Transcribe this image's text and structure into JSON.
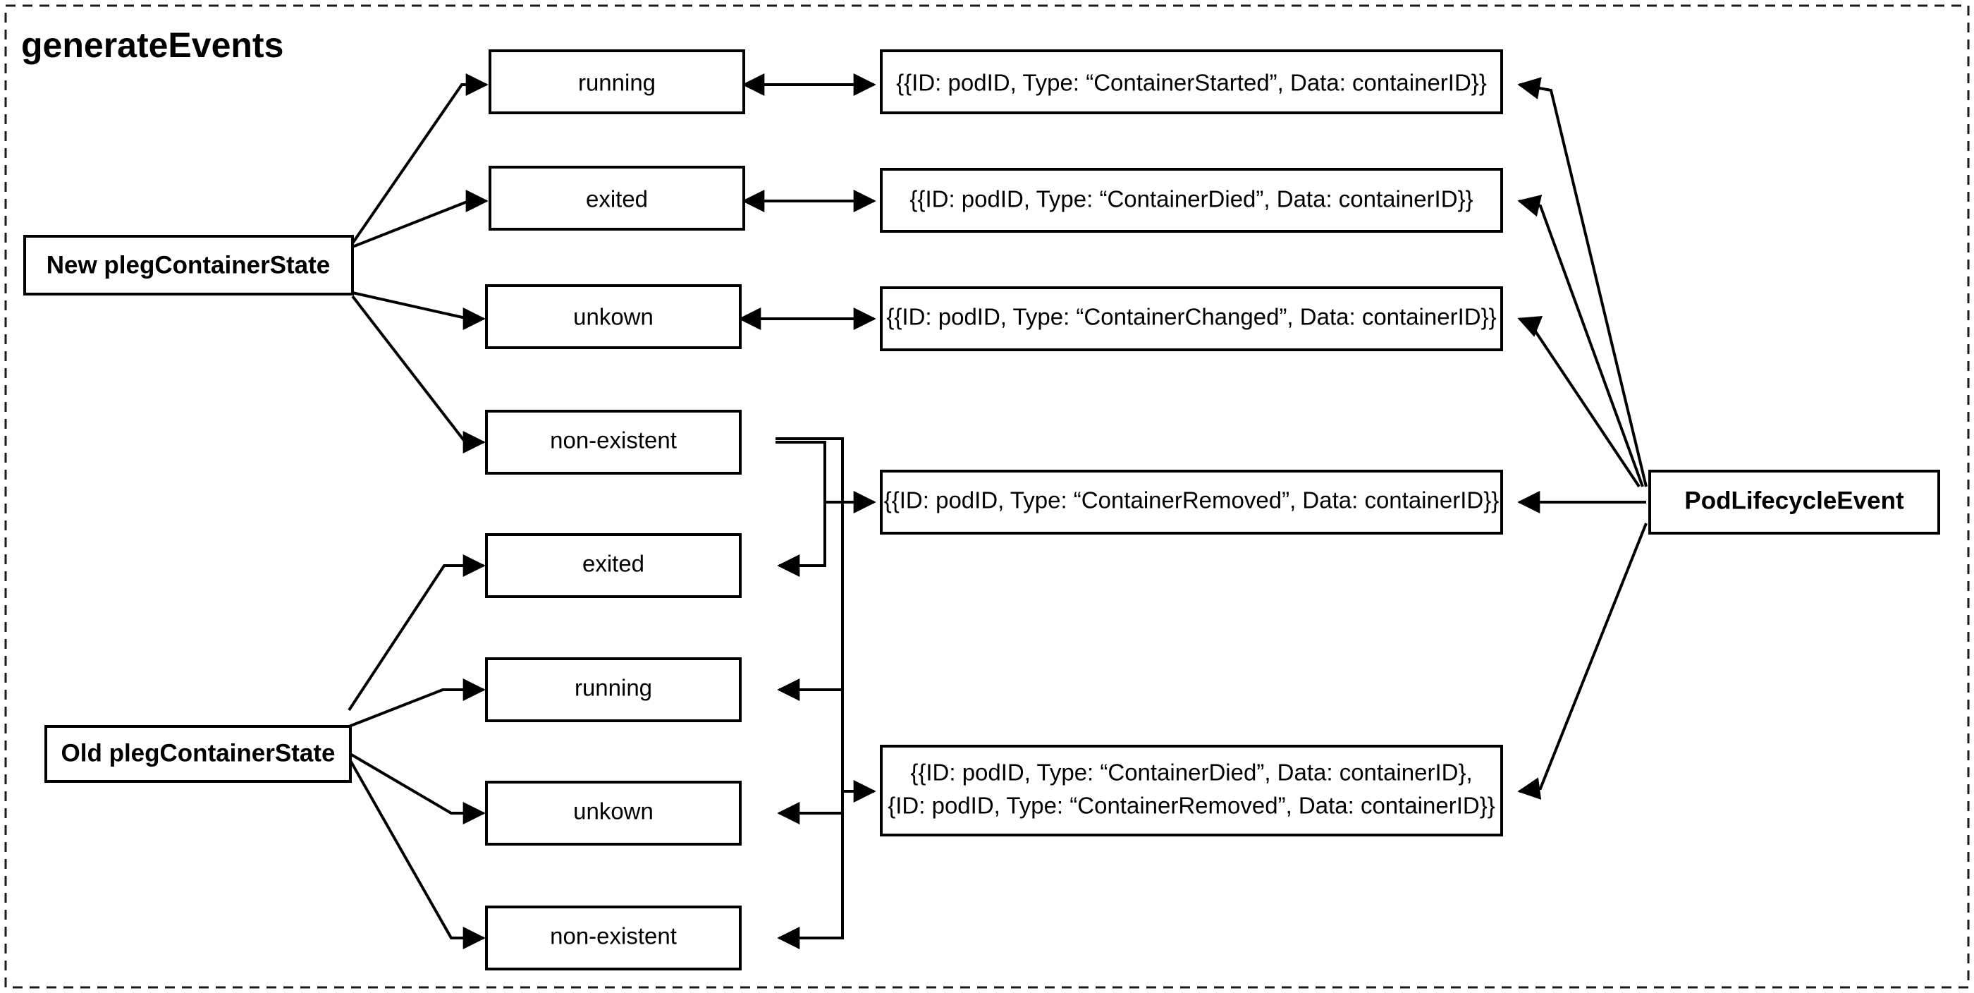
{
  "diagram": {
    "title": "generateEvents",
    "sources": [
      {
        "id": "new-state",
        "label": "New plegContainerState"
      },
      {
        "id": "old-state",
        "label": "Old plegContainerState"
      }
    ],
    "sink": {
      "id": "pod-lifecycle-event",
      "label": "PodLifecycleEvent"
    },
    "new_states": [
      {
        "id": "new-running",
        "label": "running"
      },
      {
        "id": "new-exited",
        "label": "exited"
      },
      {
        "id": "new-unkown",
        "label": "unkown"
      },
      {
        "id": "new-non-existent",
        "label": "non-existent"
      }
    ],
    "old_states": [
      {
        "id": "old-exited",
        "label": "exited"
      },
      {
        "id": "old-running",
        "label": "running"
      },
      {
        "id": "old-unkown",
        "label": "unkown"
      },
      {
        "id": "old-non-existent",
        "label": "non-existent"
      }
    ],
    "events": [
      {
        "id": "event-container-started",
        "lines": [
          "{{ID: podID, Type: “ContainerStarted”, Data: containerID}}"
        ]
      },
      {
        "id": "event-container-died",
        "lines": [
          "{{ID: podID, Type: “ContainerDied”, Data: containerID}}"
        ]
      },
      {
        "id": "event-container-changed",
        "lines": [
          "{{ID: podID, Type: “ContainerChanged”, Data: containerID}}"
        ]
      },
      {
        "id": "event-container-removed",
        "lines": [
          "{{ID: podID, Type: “ContainerRemoved”, Data: containerID}}"
        ]
      },
      {
        "id": "event-container-died-removed",
        "lines": [
          "{{ID: podID, Type: “ContainerDied”, Data: containerID},",
          "{ID: podID, Type: “ContainerRemoved”, Data: containerID}}"
        ]
      }
    ],
    "colors": {
      "background": "#ffffff",
      "stroke": "#000000",
      "frame": "#1a1a1a",
      "text": "#000000"
    }
  }
}
